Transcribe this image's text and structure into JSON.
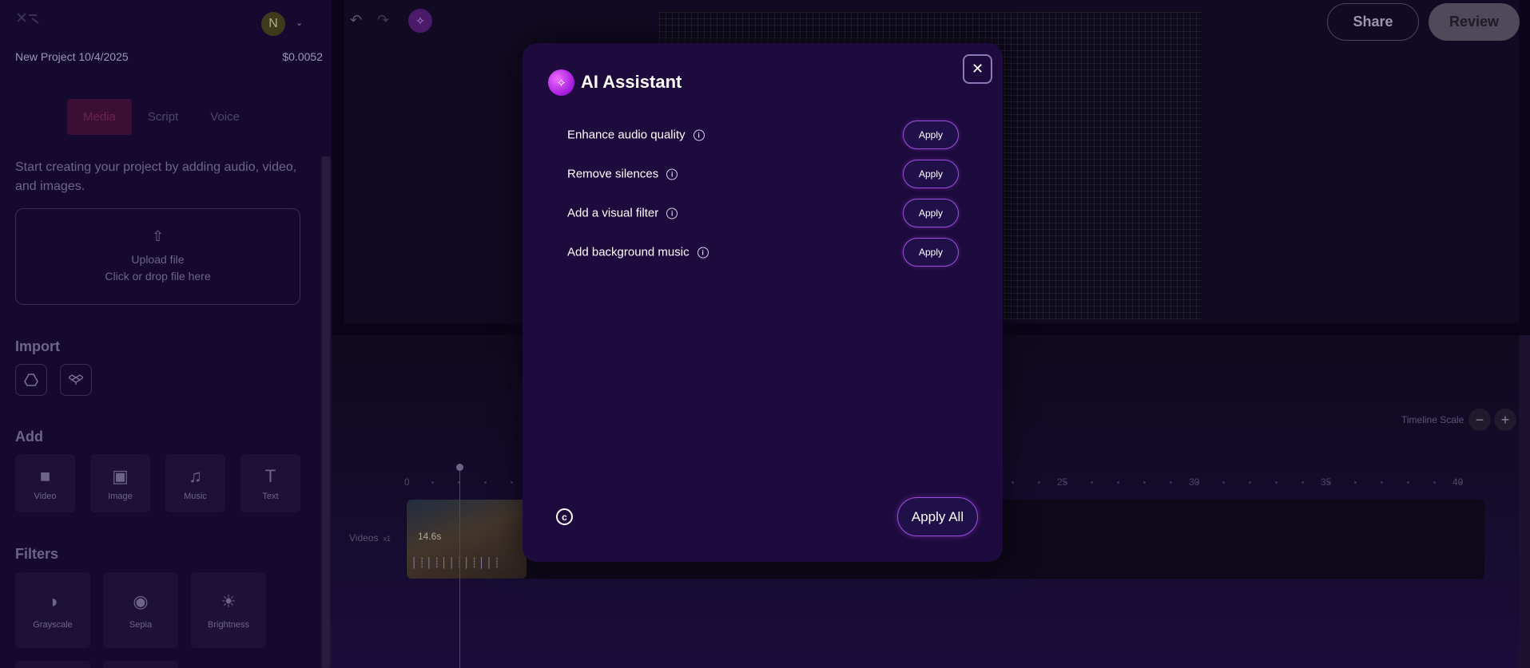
{
  "sidebar": {
    "avatar_initial": "N",
    "project_name": "New Project 10/4/2025",
    "project_cost": "$0.0052",
    "tabs": [
      {
        "label": "Media"
      },
      {
        "label": "Script"
      },
      {
        "label": "Voice"
      }
    ],
    "intro_text": "Start creating your project by adding audio, video, and images.",
    "upload": {
      "title": "Upload file",
      "subtitle": "Click or drop file here"
    },
    "import_title": "Import",
    "add_title": "Add",
    "add_items": [
      {
        "label": "Video",
        "icon": "video-icon"
      },
      {
        "label": "Image",
        "icon": "image-icon"
      },
      {
        "label": "Music",
        "icon": "music-icon"
      },
      {
        "label": "Text",
        "icon": "text-icon"
      }
    ],
    "filters_title": "Filters",
    "filters": [
      {
        "label": "Grayscale",
        "icon": "grayscale-icon"
      },
      {
        "label": "Sepia",
        "icon": "sepia-icon"
      },
      {
        "label": "Brightness",
        "icon": "brightness-icon"
      }
    ]
  },
  "topbar": {
    "share_label": "Share",
    "review_label": "Review"
  },
  "timeline": {
    "scale_label": "Timeline Scale",
    "ruler": [
      "0",
      "25",
      "30",
      "35",
      "40"
    ],
    "track_label": "Videos",
    "track_count": "x1",
    "clip_duration": "14.6s"
  },
  "modal": {
    "title": "AI Assistant",
    "options": [
      {
        "label": "Enhance audio quality",
        "button": "Apply"
      },
      {
        "label": "Remove silences",
        "button": "Apply"
      },
      {
        "label": "Add a visual filter",
        "button": "Apply"
      },
      {
        "label": "Add background music",
        "button": "Apply"
      }
    ],
    "apply_all_label": "Apply All"
  },
  "colors": {
    "accent": "#9b4fe0",
    "modal_bg": "#1c0b3c",
    "page_bg": "#0c0519"
  }
}
